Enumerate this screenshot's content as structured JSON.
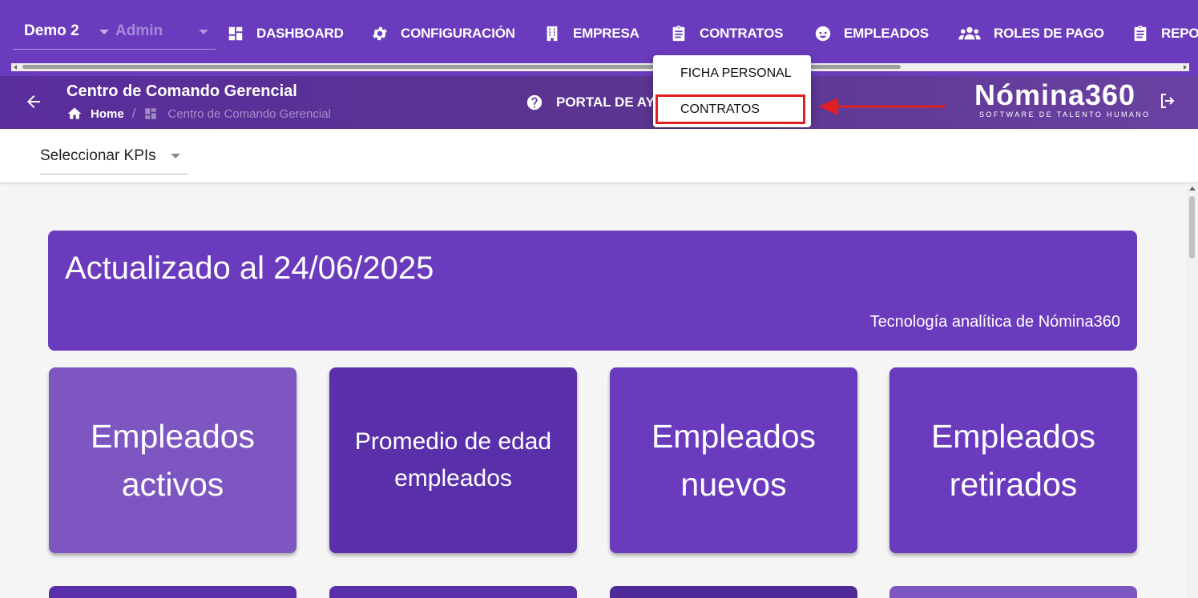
{
  "header": {
    "company": "Demo 2",
    "role": "Admin",
    "nav": [
      {
        "label": "DASHBOARD",
        "icon": "dashboard-icon"
      },
      {
        "label": "CONFIGURACIÓN",
        "icon": "gear-icon"
      },
      {
        "label": "EMPRESA",
        "icon": "building-icon"
      },
      {
        "label": "CONTRATOS",
        "icon": "clipboard-icon"
      },
      {
        "label": "EMPLEADOS",
        "icon": "face-icon"
      },
      {
        "label": "ROLES DE PAGO",
        "icon": "group-icon"
      },
      {
        "label": "REPO",
        "icon": "clipboard-icon"
      }
    ]
  },
  "subheader": {
    "title": "Centro de Comando Gerencial",
    "breadcrumb_home": "Home",
    "breadcrumb_current": "Centro de Comando Gerencial",
    "help_label": "PORTAL DE AYU",
    "brand_name": "Nómina360",
    "brand_tagline": "SOFTWARE DE TALENTO HUMANO"
  },
  "dropdown": {
    "items": [
      "FICHA PERSONAL",
      "CONTRATOS"
    ],
    "highlighted_index": 1,
    "highlight_color": "#e02020"
  },
  "kpi_selector": {
    "value": "Seleccionar KPIs"
  },
  "banner": {
    "headline": "Actualizado al 24/06/2025",
    "subtitle": "Tecnología analítica de Nómina360"
  },
  "cards": [
    {
      "label": "Empleados activos"
    },
    {
      "label": "Promedio de edad empleados"
    },
    {
      "label": "Empleados nuevos"
    },
    {
      "label": "Empleados retirados"
    }
  ],
  "colors": {
    "primary": "#6a3bbd",
    "dark": "#5a30aa",
    "light": "#7e56c2"
  }
}
